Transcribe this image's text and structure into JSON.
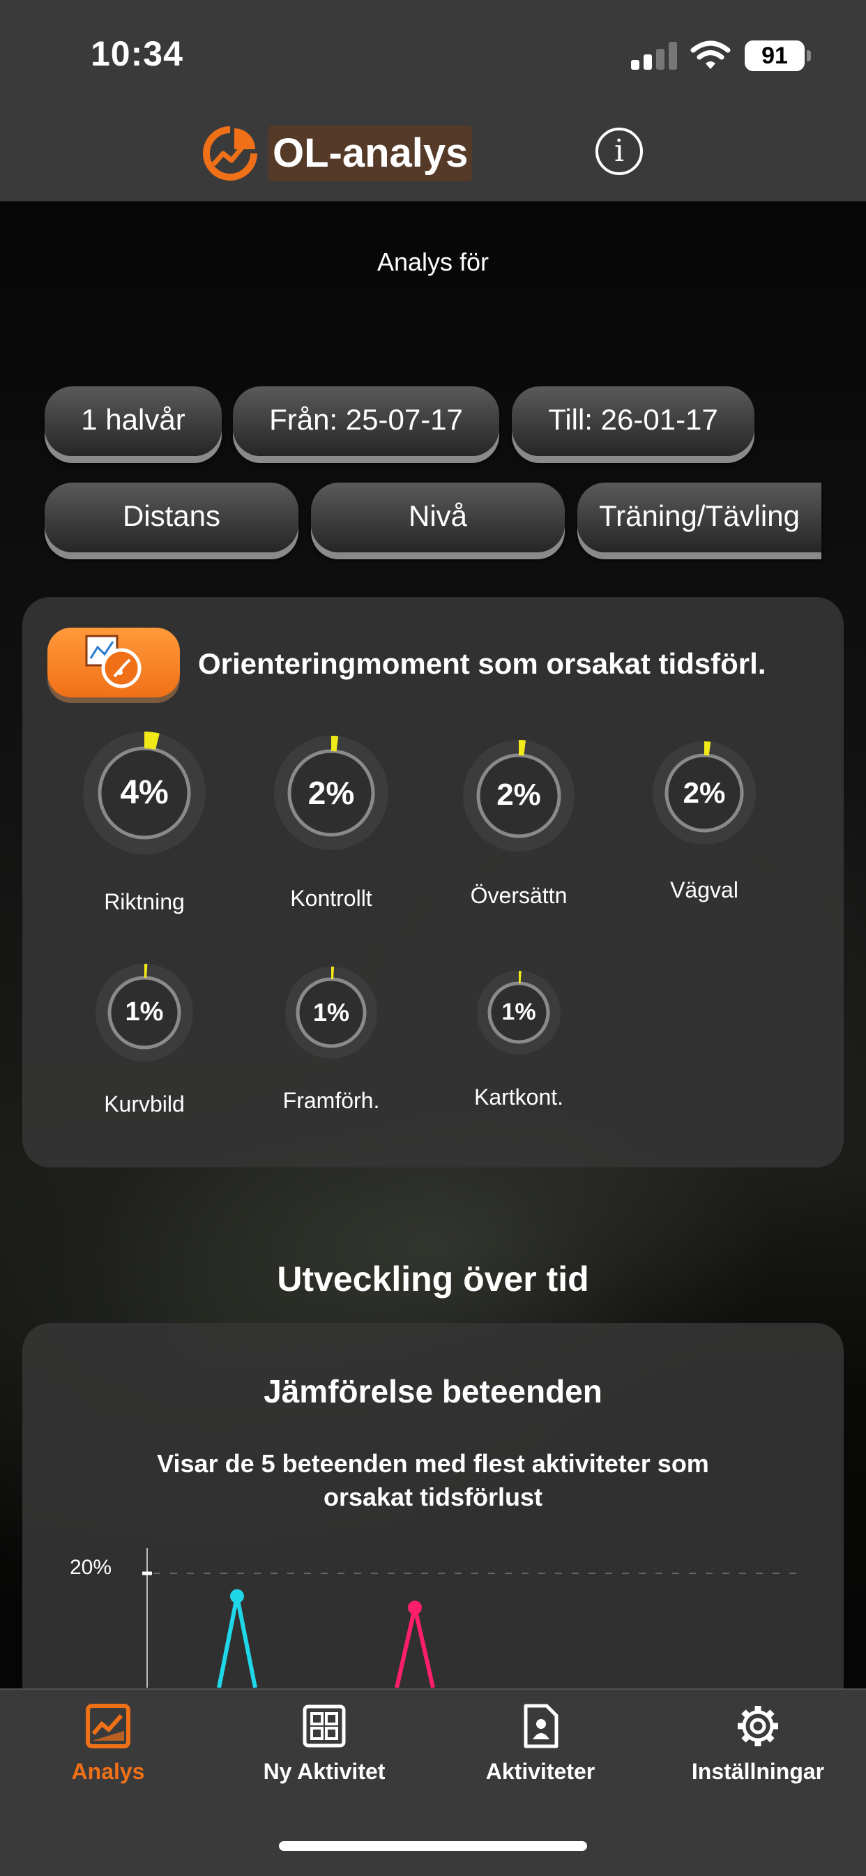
{
  "status": {
    "time": "10:34",
    "battery": "91"
  },
  "header": {
    "title": "OL-analys",
    "info_glyph": "i"
  },
  "analysis": {
    "label": "Analys för"
  },
  "filters": {
    "period": "1 halvår",
    "from": "Från: 25-07-17",
    "to": "Till: 26-01-17",
    "distance": "Distans",
    "level": "Nivå",
    "type": "Träning/Tävling"
  },
  "moments_card": {
    "title": "Orienteringmoment som orsakat tidsförl.",
    "icon": "map-compass-icon",
    "items": [
      {
        "label": "Riktning",
        "value": "4%",
        "fraction": 0.04
      },
      {
        "label": "Kontrollt",
        "value": "2%",
        "fraction": 0.02
      },
      {
        "label": "Översättn",
        "value": "2%",
        "fraction": 0.02
      },
      {
        "label": "Vägval",
        "value": "2%",
        "fraction": 0.02
      },
      {
        "label": "Kurvbild",
        "value": "1%",
        "fraction": 0.01
      },
      {
        "label": "Framförh.",
        "value": "1%",
        "fraction": 0.01
      },
      {
        "label": "Kartkont.",
        "value": "1%",
        "fraction": 0.01
      }
    ]
  },
  "development": {
    "title": "Utveckling över tid"
  },
  "comparison": {
    "title": "Jämförelse beteenden",
    "subtitle": "Visar de 5 beteenden med flest aktiviteter som orsakat tidsförlust"
  },
  "chart_data": {
    "type": "line",
    "ytick_labels": [
      "20%"
    ],
    "grid": "dashed-horizontal",
    "series": [
      {
        "color": "#1fd7e8",
        "peak_y": 16
      },
      {
        "color": "#ff1f6a",
        "peak_y": 14
      }
    ]
  },
  "tabs": [
    {
      "label": "Analys",
      "icon": "chart-icon",
      "active": true
    },
    {
      "label": "Ny Aktivitet",
      "icon": "grid-icon",
      "active": false
    },
    {
      "label": "Aktiviteter",
      "icon": "document-person-icon",
      "active": false
    },
    {
      "label": "Inställningar",
      "icon": "gear-icon",
      "active": false
    }
  ],
  "colors": {
    "accent": "#f07018",
    "ring_fill": "#f2ea18",
    "ring_track": "#3c3c3c"
  }
}
